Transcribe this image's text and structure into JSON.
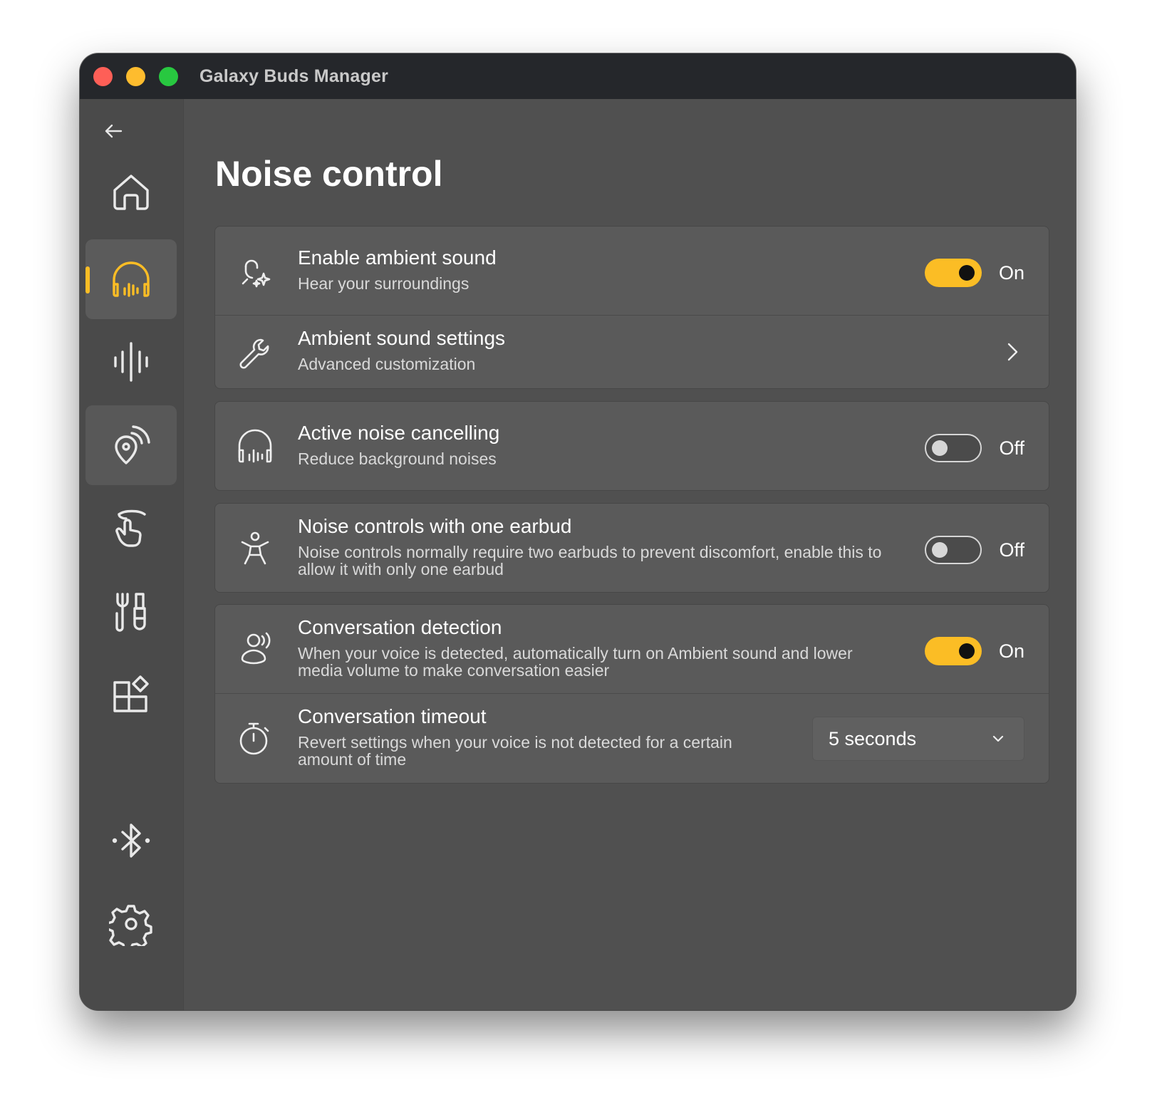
{
  "window": {
    "title": "Galaxy Buds Manager"
  },
  "sidebar": {
    "items": [
      {
        "icon": "home-icon"
      },
      {
        "icon": "headphones-icon",
        "active": true
      },
      {
        "icon": "equalizer-icon"
      },
      {
        "icon": "find-location-icon"
      },
      {
        "icon": "touch-gesture-icon"
      },
      {
        "icon": "tools-icon"
      },
      {
        "icon": "apps-icon"
      },
      {
        "icon": "bluetooth-icon"
      },
      {
        "icon": "gear-icon"
      }
    ],
    "accent": "#fbbd25"
  },
  "page": {
    "title": "Noise control"
  },
  "settings": {
    "ambient": {
      "title": "Enable ambient sound",
      "subtitle": "Hear your surroundings",
      "state": "On",
      "icon": "ambient-mic-sparkle-icon"
    },
    "ambient_settings": {
      "title": "Ambient sound settings",
      "subtitle": "Advanced customization",
      "icon": "wrench-icon"
    },
    "anc": {
      "title": "Active noise cancelling",
      "subtitle": "Reduce background noises",
      "state": "Off",
      "icon": "headphones-icon"
    },
    "one_earbud": {
      "title": "Noise controls with one earbud",
      "subtitle": "Noise controls normally require two earbuds to prevent discomfort, enable this to allow it with only one earbud",
      "state": "Off",
      "icon": "accessibility-person-icon"
    },
    "conversation": {
      "title": "Conversation detection",
      "subtitle": "When your voice is detected, automatically turn on Ambient sound and lower media volume to make conversation easier",
      "state": "On",
      "icon": "person-speaking-icon"
    },
    "timeout": {
      "title": "Conversation timeout",
      "subtitle": "Revert settings when your voice is not detected for a certain amount of time",
      "value": "5 seconds",
      "icon": "stopwatch-icon"
    }
  }
}
